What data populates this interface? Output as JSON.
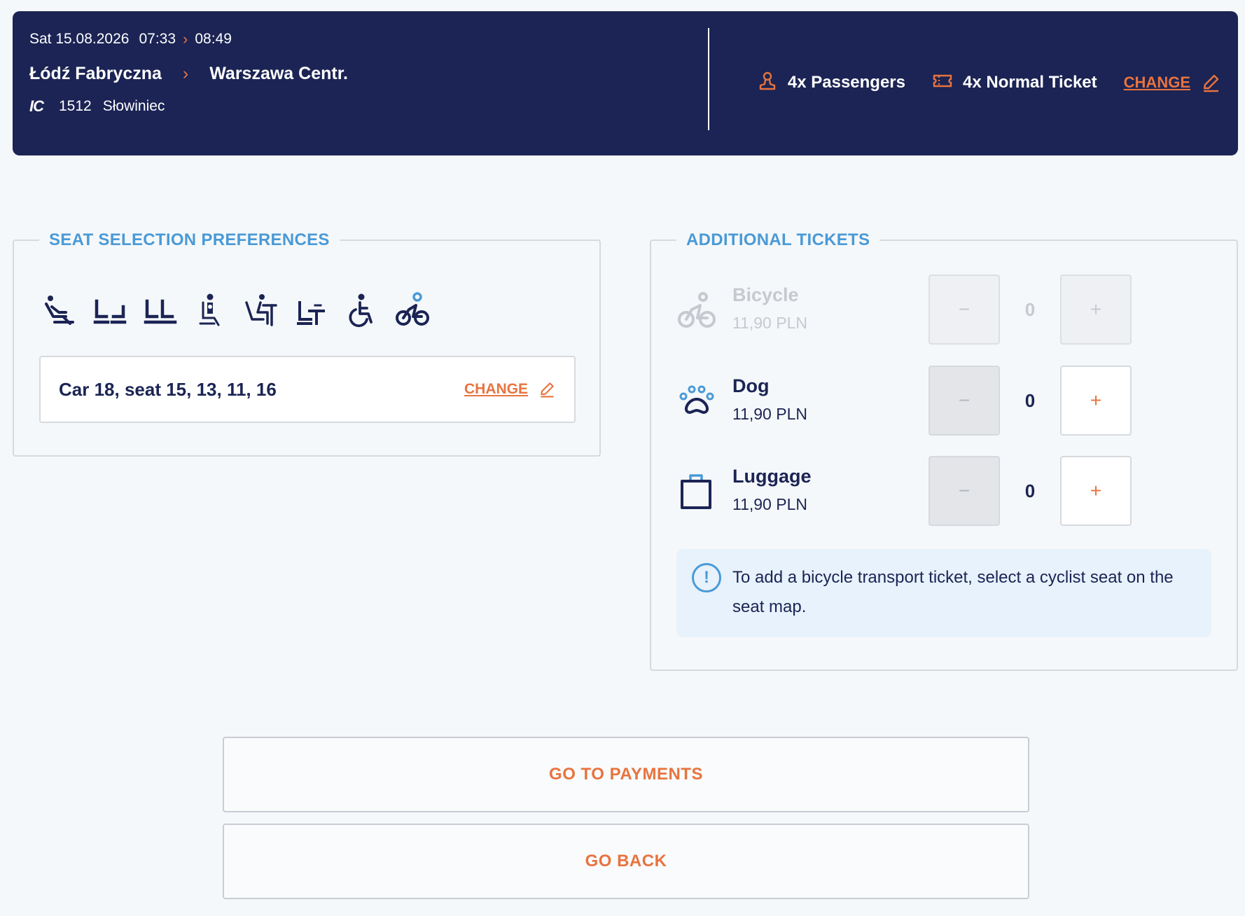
{
  "header": {
    "date": "Sat 15.08.2026",
    "departure_time": "07:33",
    "arrival_time": "08:49",
    "from_station": "Łódź Fabryczna",
    "to_station": "Warszawa Centr.",
    "carrier_logo": "IC",
    "train_number": "1512",
    "train_name": "Słowiniec",
    "passengers": "4x Passengers",
    "ticket_type": "4x Normal Ticket",
    "change_label": "CHANGE"
  },
  "seat_preferences": {
    "legend": "SEAT SELECTION PREFERENCES",
    "icons": [
      "recliner-seat-icon",
      "seats-facing-icon",
      "seats-in-row-icon",
      "parent-child-seat-icon",
      "seat-with-table-icon",
      "seat-with-small-table-icon",
      "wheelchair-icon",
      "cyclist-icon"
    ],
    "selected_seats": "Car 18, seat 15, 13, 11, 16",
    "change_label": "CHANGE"
  },
  "additional_tickets": {
    "legend": "ADDITIONAL TICKETS",
    "items": [
      {
        "name": "Bicycle",
        "price": "11,90 PLN",
        "quantity": "0",
        "disabled": true
      },
      {
        "name": "Dog",
        "price": "11,90 PLN",
        "quantity": "0",
        "disabled": false
      },
      {
        "name": "Luggage",
        "price": "11,90 PLN",
        "quantity": "0",
        "disabled": false
      }
    ],
    "minus_label": "−",
    "plus_label": "+",
    "info_icon": "!",
    "info_text": "To add a bicycle transport ticket, select a cyclist seat on the seat map."
  },
  "actions": {
    "go_to_payments": "GO TO PAYMENTS",
    "go_back": "GO BACK"
  },
  "colors": {
    "navy": "#1b2454",
    "accent": "#e8733f",
    "legend_blue": "#4a9ad6",
    "info_bg": "#e7f2fc"
  }
}
